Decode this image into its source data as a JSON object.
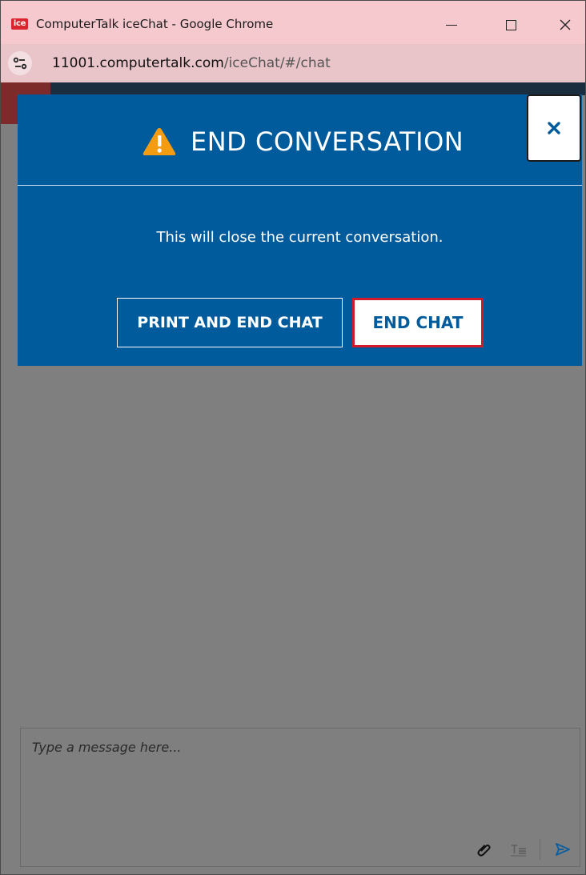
{
  "browser": {
    "window_title": "ComputerTalk iceChat - Google Chrome",
    "app_icon_text": "ice",
    "url_host": "11001.computertalk.com",
    "url_path": "/iceChat/#/chat"
  },
  "modal": {
    "title": "END CONVERSATION",
    "message": "This will close the current conversation.",
    "print_button": "PRINT AND END CHAT",
    "end_button": "END CHAT",
    "close_label": "×"
  },
  "composer": {
    "placeholder": "Type a message here..."
  },
  "icons": {
    "app": "ice-app-icon",
    "site_info": "site-settings-icon",
    "warning": "warning-icon",
    "close": "close-icon",
    "attach": "paperclip-icon",
    "format": "text-format-icon",
    "send": "send-icon"
  },
  "colors": {
    "modal_bg": "#005b9c",
    "end_button_border": "#d11a2a",
    "warning": "#f39c12",
    "overlay": "#7f7f7f",
    "titlebar": "#f6c9cf"
  }
}
